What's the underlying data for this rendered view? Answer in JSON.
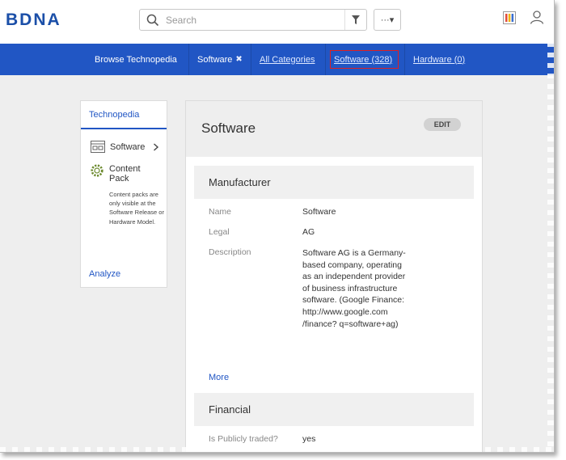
{
  "header": {
    "logo_text": "BDNA",
    "search_placeholder": "Search",
    "more_label": "···▾"
  },
  "nav": {
    "browse": "Browse Technopedia",
    "filter_chip": "Software",
    "filter_chip_remove": "✖",
    "all_categories": "All Categories",
    "software": "Software (328)",
    "hardware": "Hardware (0)"
  },
  "left_panel": {
    "tab": "Technopedia",
    "software_item": "Software",
    "content_pack": "Content Pack",
    "content_pack_note": "Content packs are only visible at the Software Release or Hardware Model.",
    "analyze": "Analyze"
  },
  "card": {
    "title": "Software",
    "edit_label": "EDIT",
    "manufacturer_section": "Manufacturer",
    "fields": [
      {
        "label": "Name",
        "value": "Software"
      },
      {
        "label": "Legal",
        "value": "AG"
      },
      {
        "label": "Description",
        "value": "Software AG is a Germany-based company, operating as an independent provider of business infrastructure software. (Google Finance: http://www.google.com /finance? q=software+ag)"
      }
    ],
    "more_link": "More",
    "financial_section": "Financial",
    "financial_fields": [
      {
        "label": "Is Publicly traded?",
        "value": "yes"
      }
    ]
  },
  "colors": {
    "brand_blue": "#2156c4",
    "selection_red": "#e02020"
  }
}
